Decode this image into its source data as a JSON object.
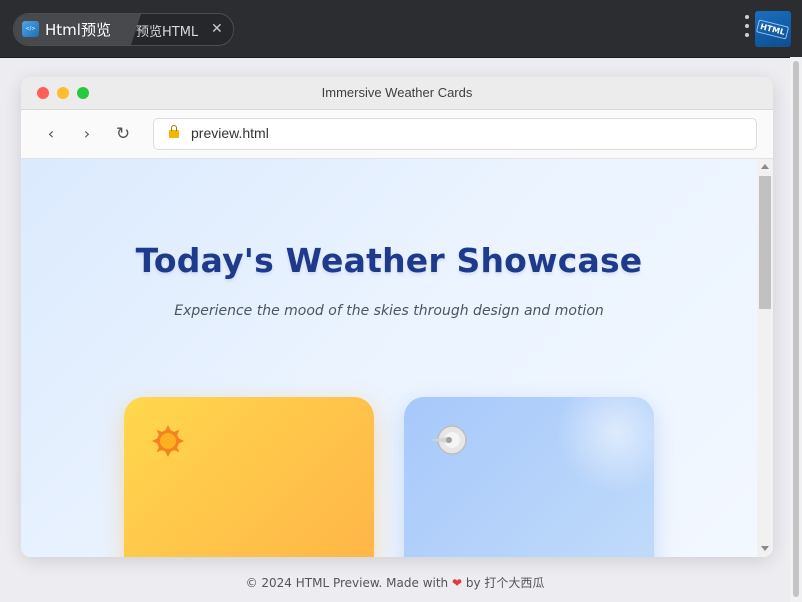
{
  "app": {
    "tabs": [
      {
        "label": "Html预览",
        "active": true
      },
      {
        "label": "预览HTML",
        "active": false
      }
    ],
    "logo_text": "HTML"
  },
  "window": {
    "title": "Immersive Weather Cards",
    "url": "preview.html"
  },
  "page": {
    "headline": "Today's Weather Showcase",
    "subhead": "Experience the mood of the skies through design and motion",
    "cards": [
      {
        "kind": "sunny",
        "icon": "sun-icon"
      },
      {
        "kind": "windy",
        "icon": "wind-icon"
      }
    ]
  },
  "footer": {
    "prefix": "© 2024 HTML Preview. Made with",
    "suffix": "by 打个大西瓜"
  },
  "colors": {
    "headline": "#1e3a8a",
    "sunny_card": "#ffc24a",
    "windy_card": "#b7d4fa",
    "heart": "#e23a3a"
  }
}
